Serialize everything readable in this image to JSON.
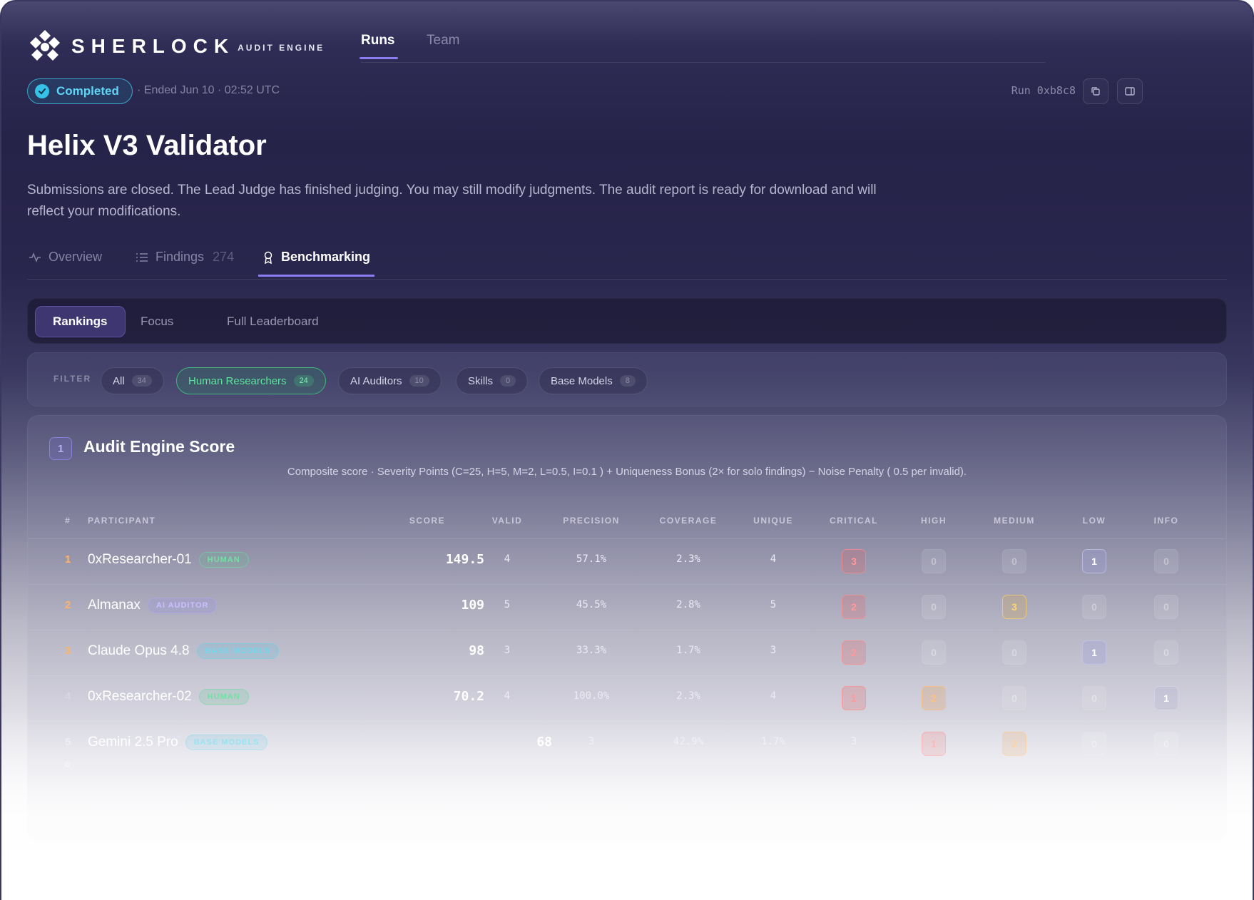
{
  "brand": {
    "name": "SHERLOCK",
    "sub": "AUDIT ENGINE"
  },
  "topnav": {
    "runs": "Runs",
    "team": "Team"
  },
  "status": {
    "label": "Completed",
    "ended": "· Ended Jun 10 · 02:52 UTC",
    "run_id": "Run 0xb8c8"
  },
  "page": {
    "title": "Helix V3 Validator",
    "description": "Submissions are closed. The Lead Judge has finished judging. You may still modify judgments. The audit report is ready for download and will reflect your modifications."
  },
  "subtabs": {
    "overview": "Overview",
    "findings": "Findings",
    "findings_count": "274",
    "benchmarking": "Benchmarking"
  },
  "views": {
    "rankings": "Rankings",
    "focus": "Focus",
    "full": "Full Leaderboard"
  },
  "filter": {
    "label": "FILTER",
    "chips": [
      {
        "label": "All",
        "count": "34"
      },
      {
        "label": "Human Researchers",
        "count": "24"
      },
      {
        "label": "AI Auditors",
        "count": "10"
      },
      {
        "label": "Skills",
        "count": "0"
      },
      {
        "label": "Base Models",
        "count": "8"
      }
    ]
  },
  "score_card": {
    "index": "1",
    "title": "Audit Engine Score",
    "formula": "Composite score · Severity Points (C=25, H=5, M=2, L=0.5, I=0.1 ) + Uniqueness Bonus (2× for solo findings) − Noise Penalty ( 0.5 per invalid)."
  },
  "columns": {
    "rank": "#",
    "participant": "PARTICIPANT",
    "score": "SCORE",
    "valid": "VALID",
    "precision": "PRECISION",
    "coverage": "COVERAGE",
    "unique": "UNIQUE",
    "critical": "CRITICAL",
    "high": "HIGH",
    "medium": "MEDIUM",
    "low": "LOW",
    "info": "INFO"
  },
  "rows": [
    {
      "rank": "1",
      "name": "0xResearcher-01",
      "tag": "HUMAN",
      "score": "149.5",
      "valid": "4",
      "precision": "57.1%",
      "coverage": "2.3%",
      "unique": "4",
      "critical": "3",
      "high": "0",
      "medium": "0",
      "low": "1",
      "info": "0"
    },
    {
      "rank": "2",
      "name": "Almanax",
      "tag": "AI AUDITOR",
      "score": "109",
      "valid": "5",
      "precision": "45.5%",
      "coverage": "2.8%",
      "unique": "5",
      "critical": "2",
      "high": "0",
      "medium": "3",
      "low": "0",
      "info": "0"
    },
    {
      "rank": "3",
      "name": "Claude Opus 4.8",
      "tag": "BASE MODELS",
      "score": "98",
      "valid": "3",
      "precision": "33.3%",
      "coverage": "1.7%",
      "unique": "3",
      "critical": "2",
      "high": "0",
      "medium": "0",
      "low": "1",
      "info": "0"
    },
    {
      "rank": "4",
      "name": "0xResearcher-02",
      "tag": "HUMAN",
      "score": "70.2",
      "valid": "4",
      "precision": "100.0%",
      "coverage": "2.3%",
      "unique": "4",
      "critical": "1",
      "high": "2",
      "medium": "0",
      "low": "0",
      "info": "1"
    },
    {
      "rank": "5",
      "name": "Gemini 2.5 Pro",
      "tag": "BASE MODELS",
      "score": "68",
      "valid": "3",
      "precision": "42.9%",
      "coverage": "1.7%",
      "unique": "3",
      "critical": "1",
      "high": "2",
      "medium": "0",
      "low": "0",
      "info": "",
      "rank_next": "6"
    }
  ],
  "colors": {
    "accent": "#8b7cf0",
    "completed": "#5fd4f4",
    "human": "#5be39a"
  }
}
